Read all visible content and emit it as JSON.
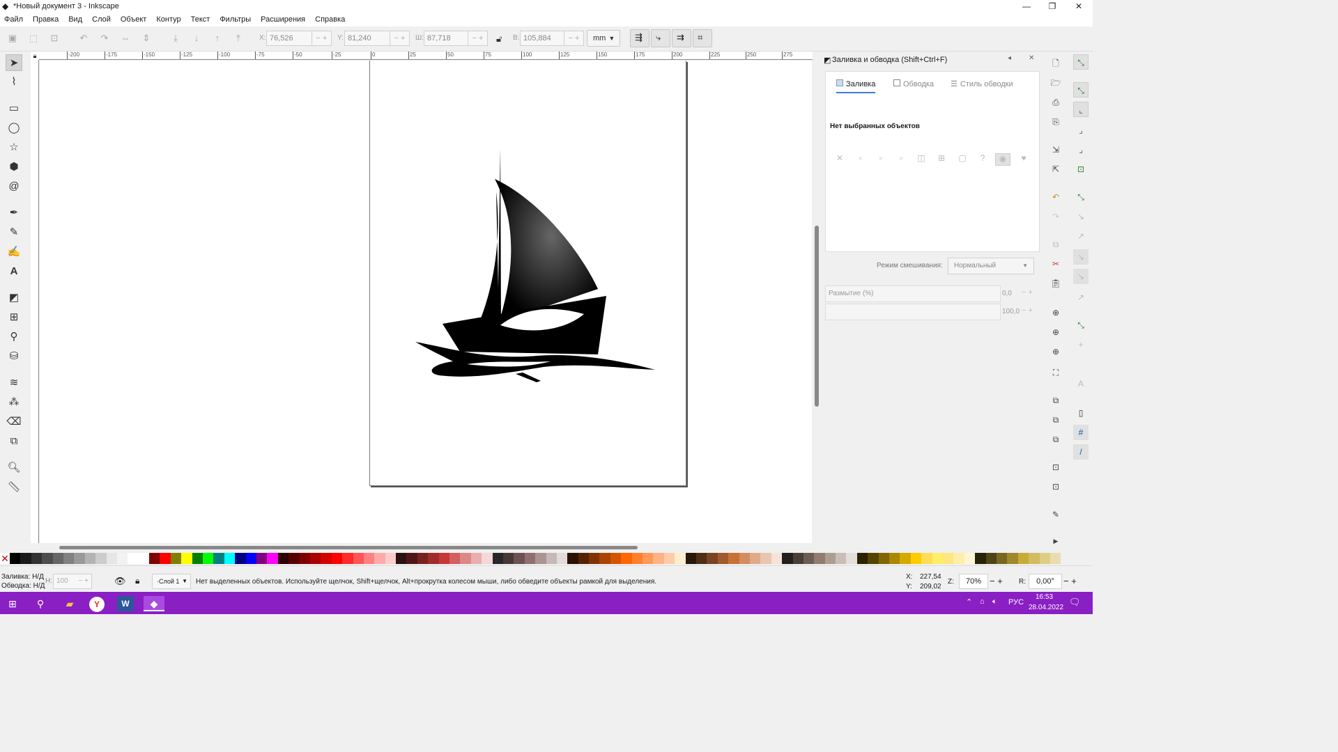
{
  "window": {
    "title": "*Новый документ 3 - Inkscape",
    "minimize": "—",
    "maximize": "❐",
    "close": "✕"
  },
  "menu": [
    "Файл",
    "Правка",
    "Вид",
    "Слой",
    "Объект",
    "Контур",
    "Текст",
    "Фильтры",
    "Расширения",
    "Справка"
  ],
  "toolbar": {
    "x_label": "X:",
    "x_value": "76,526",
    "y_label": "Y:",
    "y_value": "81,240",
    "w_label": "Ш:",
    "w_value": "87,718",
    "h_label": "В:",
    "h_value": "105,884",
    "unit": "mm"
  },
  "ruler_ticks": [
    "-200",
    "-175",
    "-150",
    "-125",
    "-100",
    "-75",
    "-50",
    "-25",
    "0",
    "25",
    "50",
    "75",
    "100",
    "125",
    "150",
    "175",
    "200",
    "225",
    "250",
    "275"
  ],
  "dock": {
    "title": "Заливка и обводка (Shift+Ctrl+F)",
    "tabs": [
      "Заливка",
      "Обводка",
      "Стиль обводки"
    ],
    "no_selection": "Нет выбранных объектов",
    "blend_label": "Режим смешивания:",
    "blend_value": "Нормальный",
    "blur_label": "Размытие (%)",
    "blur_value": "0,0",
    "opacity_value": "100,0"
  },
  "status": {
    "fill_label": "Заливка:",
    "fill_value": "Н/Д",
    "stroke_label": "Обводка:",
    "stroke_value": "Н/Д",
    "h_label": "Н:",
    "opacity": "100",
    "layer": "·Слой 1",
    "message": "Нет выделенных объектов. Используйте щелчок, Shift+щелчок, Alt+прокрутка колесом мыши, либо обведите объекты рамкой для выделения.",
    "cx_label": "X:",
    "cx": "227,54",
    "cy_label": "Y:",
    "cy": "209,02",
    "z_label": "Z:",
    "zoom": "70%",
    "r_label": "R:",
    "rotation": "0,00°"
  },
  "taskbar": {
    "lang": "РУС",
    "time": "16:53",
    "date": "28.04.2022"
  },
  "colors": {
    "accent": "#8a1fc4",
    "tab_active": "#3c7ad8"
  }
}
